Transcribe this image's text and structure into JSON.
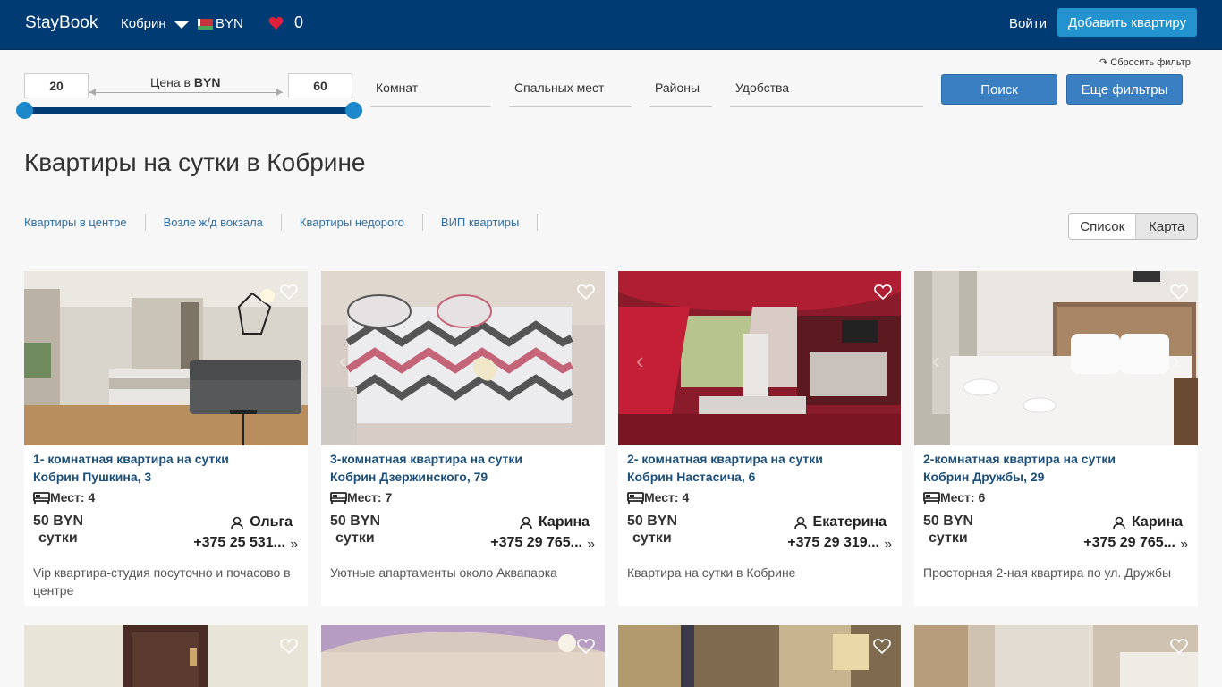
{
  "header": {
    "brand": "StayBook",
    "city": "Кобрин",
    "currency": "BYN",
    "favorites_count": "0",
    "login": "Войти",
    "add_listing": "Добавить квартиру"
  },
  "filters": {
    "reset": "↷ Сбросить фильтр",
    "price_min": "20",
    "price_max": "60",
    "price_label": "Цена в",
    "price_currency": "BYN",
    "rooms": "Комнат",
    "beds": "Спальных мест",
    "districts": "Районы",
    "amenities": "Удобства",
    "search": "Поиск",
    "more_filters": "Еще фильтры"
  },
  "page_title": "Квартиры на сутки в Кобрине",
  "quicklinks": [
    "Квартиры в центре",
    "Возле ж/д вокзала",
    "Квартиры недорого",
    "ВИП квартиры"
  ],
  "view_toggle": {
    "list": "Список",
    "map": "Карта"
  },
  "listings": [
    {
      "title": "1- комнатная квартира на сутки",
      "address": "Кобрин Пушкина, 3",
      "places": "Мест: 4",
      "price": "50 BYN",
      "per": "сутки",
      "host": "Ольга",
      "phone": "+375 25 531...",
      "description": "Vip квартира-студия посуточно и почасово в центре"
    },
    {
      "title": "3-комнатная квартира на сутки",
      "address": "Кобрин Дзержинского, 79",
      "places": "Мест: 7",
      "price": "50 BYN",
      "per": "сутки",
      "host": "Карина",
      "phone": "+375 29 765...",
      "description": "Уютные апартаменты около Аквапарка"
    },
    {
      "title": "2- комнатная квартира на сутки",
      "address": "Кобрин Настасича, 6",
      "places": "Мест: 4",
      "price": "50 BYN",
      "per": "сутки",
      "host": "Екатерина",
      "phone": "+375 29 319...",
      "description": "Квартира на сутки в Кобрине"
    },
    {
      "title": "2-комнатная квартира на сутки",
      "address": "Кобрин Дружбы, 29",
      "places": "Мест: 6",
      "price": "50 BYN",
      "per": "сутки",
      "host": "Карина",
      "phone": "+375 29 765...",
      "description": "Просторная 2-ная квартира по ул. Дружбы"
    }
  ],
  "colors": {
    "header_bg": "#003b73",
    "accent": "#2393d0",
    "button": "#3a7fc1",
    "link": "#2e6da4",
    "title": "#1b4f7a"
  }
}
